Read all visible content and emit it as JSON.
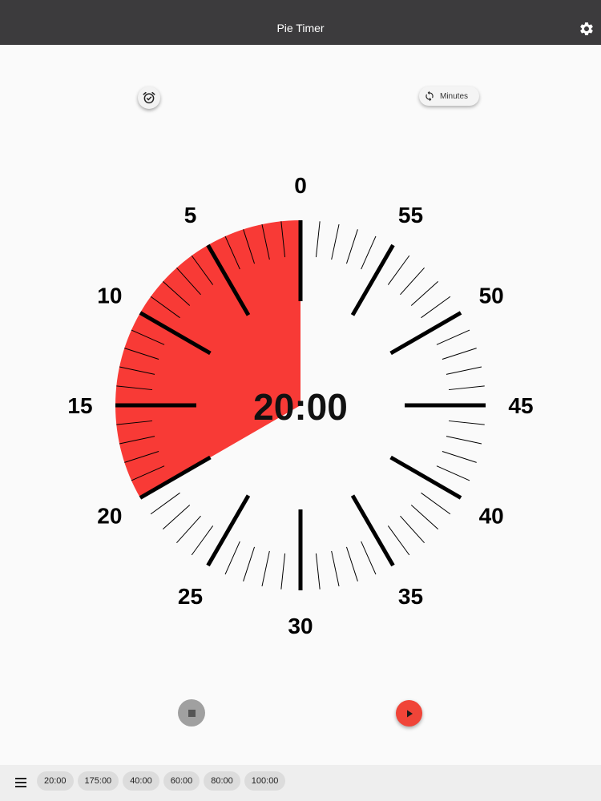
{
  "app": {
    "title": "Pie Timer"
  },
  "header": {
    "settings_icon": "gear-icon"
  },
  "controls": {
    "alarm_icon": "alarm-check-icon",
    "unit_toggle": {
      "icon": "refresh-icon",
      "label": "Minutes"
    }
  },
  "dial": {
    "labels": [
      "0",
      "5",
      "10",
      "15",
      "20",
      "25",
      "30",
      "35",
      "40",
      "45",
      "50",
      "55"
    ],
    "remaining_minutes": 20,
    "total_minutes": 60,
    "pie_color": "#f83a36"
  },
  "timer": {
    "display": "20:00"
  },
  "playback": {
    "stop_icon": "stop-icon",
    "play_icon": "play-icon"
  },
  "bottom_bar": {
    "menu_icon": "menu-icon",
    "presets": [
      "20:00",
      "175:00",
      "40:00",
      "60:00",
      "80:00",
      "100:00"
    ]
  },
  "colors": {
    "appbar": "#3c3b3d",
    "accent": "#f04438"
  }
}
